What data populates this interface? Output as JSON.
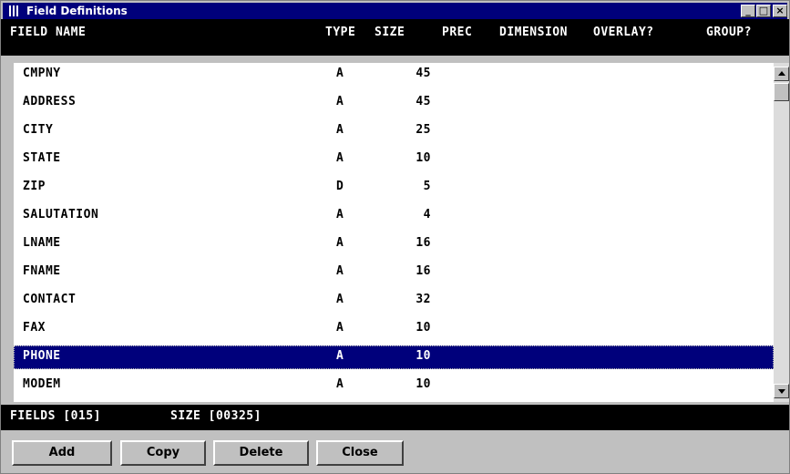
{
  "window": {
    "title": "Field Definitions",
    "minimize_label": "_",
    "maximize_label": "□",
    "close_label": "×"
  },
  "columns": [
    "FIELD NAME",
    "TYPE",
    "SIZE",
    "PREC",
    "DIMENSION",
    "OVERLAY?",
    "GROUP?"
  ],
  "rows": [
    {
      "name": "CMPNY",
      "type": "A",
      "size": "45",
      "selected": false
    },
    {
      "name": "ADDRESS",
      "type": "A",
      "size": "45",
      "selected": false
    },
    {
      "name": "CITY",
      "type": "A",
      "size": "25",
      "selected": false
    },
    {
      "name": "STATE",
      "type": "A",
      "size": "10",
      "selected": false
    },
    {
      "name": "ZIP",
      "type": "D",
      "size": "5",
      "selected": false
    },
    {
      "name": "SALUTATION",
      "type": "A",
      "size": "4",
      "selected": false
    },
    {
      "name": "LNAME",
      "type": "A",
      "size": "16",
      "selected": false
    },
    {
      "name": "FNAME",
      "type": "A",
      "size": "16",
      "selected": false
    },
    {
      "name": "CONTACT",
      "type": "A",
      "size": "32",
      "selected": false
    },
    {
      "name": "FAX",
      "type": "A",
      "size": "10",
      "selected": false
    },
    {
      "name": "PHONE",
      "type": "A",
      "size": "10",
      "selected": true
    },
    {
      "name": "MODEM",
      "type": "A",
      "size": "10",
      "selected": false
    }
  ],
  "status": {
    "fields": "FIELDS [015]",
    "size": "SIZE [00325]"
  },
  "buttons": {
    "add": "Add",
    "copy": "Copy",
    "delete": "Delete",
    "close": "Close"
  },
  "colors": {
    "titlebar": "#00007b",
    "selection": "#00007b",
    "header_bg": "#000000",
    "face": "#c0c0c0"
  }
}
